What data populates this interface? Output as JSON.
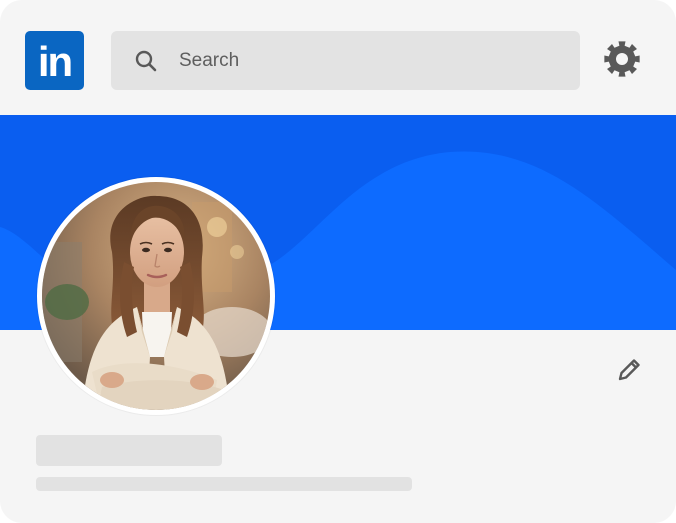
{
  "header": {
    "logo_text": "in",
    "search": {
      "placeholder": "Search"
    },
    "icons": {
      "search": "search-icon",
      "settings": "gear-icon"
    }
  },
  "profile": {
    "photo": "profile-photo",
    "edit_icon": "pencil-icon"
  },
  "colors": {
    "brand": "#0a66c2",
    "banner": "#0a5ef0",
    "banner_wave": "#0d6bff",
    "background": "#f5f5f5",
    "search_bg": "#e3e3e3",
    "icon": "#595959",
    "skeleton": "#e2e2e2"
  }
}
